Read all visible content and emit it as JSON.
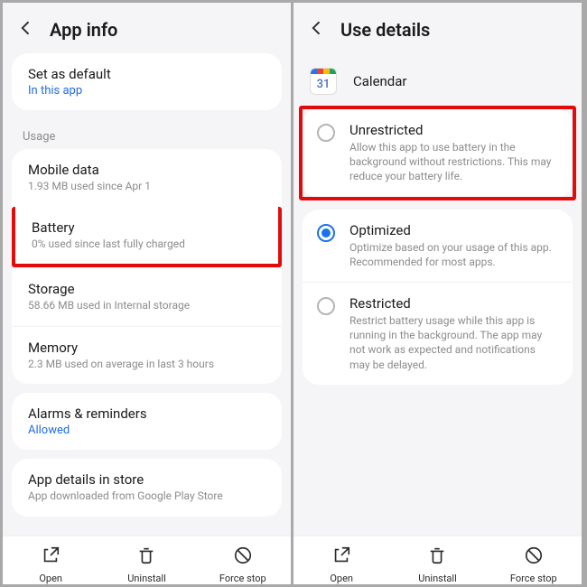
{
  "left": {
    "title": "App info",
    "set_default": {
      "title": "Set as default",
      "sub": "In this app"
    },
    "usage_label": "Usage",
    "mobile_data": {
      "title": "Mobile data",
      "sub": "1.93 MB used since Apr 1"
    },
    "battery": {
      "title": "Battery",
      "sub": "0% used since last fully charged"
    },
    "storage": {
      "title": "Storage",
      "sub": "58.66 MB used in Internal storage"
    },
    "memory": {
      "title": "Memory",
      "sub": "2.3 MB used on average in last 3 hours"
    },
    "alarms": {
      "title": "Alarms & reminders",
      "sub": "Allowed"
    },
    "details": {
      "title": "App details in store",
      "sub": "App downloaded from Google Play Store"
    },
    "bottom": {
      "open": "Open",
      "uninstall": "Uninstall",
      "force": "Force stop"
    }
  },
  "right": {
    "title": "Use details",
    "app_name": "Calendar",
    "cal_day": "31",
    "unrestricted": {
      "title": "Unrestricted",
      "sub": "Allow this app to use battery in the background without restrictions. This may reduce your battery life."
    },
    "optimized": {
      "title": "Optimized",
      "sub": "Optimize based on your usage of this app. Recommended for most apps."
    },
    "restricted": {
      "title": "Restricted",
      "sub": "Restrict battery usage while this app is running in the background. The app may not work as expected and notifications may be delayed."
    },
    "bottom": {
      "open": "Open",
      "uninstall": "Uninstall",
      "force": "Force stop"
    }
  }
}
